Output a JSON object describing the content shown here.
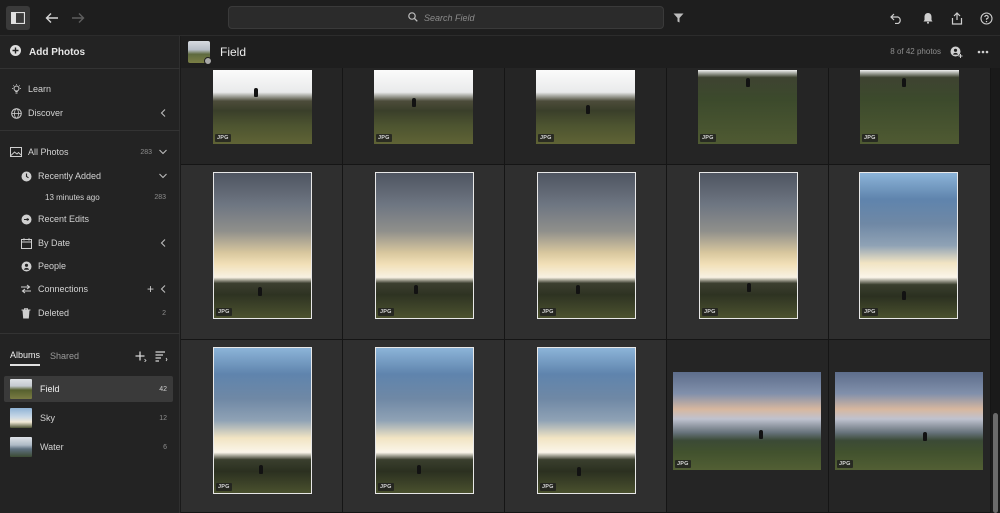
{
  "topbar": {
    "search_placeholder": "Search Field"
  },
  "sidebar": {
    "add_photos": "Add Photos",
    "learn": "Learn",
    "discover": "Discover",
    "all_photos": {
      "label": "All Photos",
      "count": "283"
    },
    "recently_added": {
      "label": "Recently Added",
      "sub_label": "13 minutes ago",
      "count": "283"
    },
    "recent_edits": "Recent Edits",
    "by_date": "By Date",
    "people": "People",
    "connections": "Connections",
    "deleted": {
      "label": "Deleted",
      "count": "2"
    },
    "tabs": {
      "albums": "Albums",
      "shared": "Shared"
    },
    "albums": [
      {
        "name": "Field",
        "count": "42"
      },
      {
        "name": "Sky",
        "count": "12"
      },
      {
        "name": "Water",
        "count": "6"
      }
    ]
  },
  "main": {
    "album_title": "Field",
    "photo_count": "8 of 42 photos",
    "badge": "JPG"
  }
}
